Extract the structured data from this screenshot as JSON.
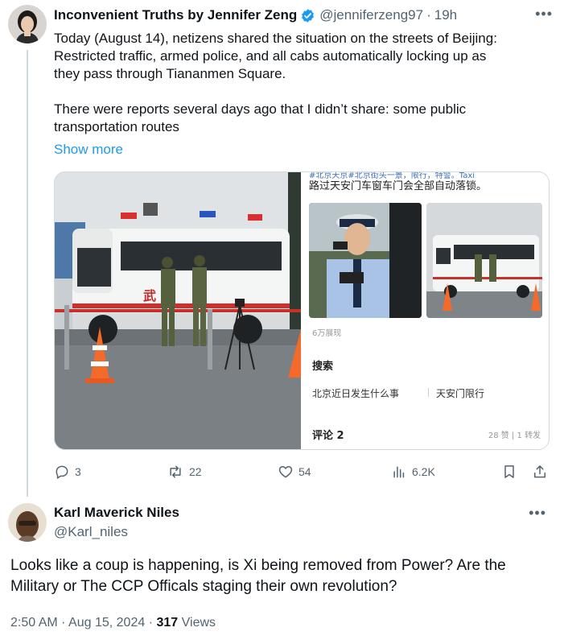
{
  "tweet": {
    "author_name": "Inconvenient Truths by Jennifer Zeng",
    "handle": "@jenniferzeng97",
    "separator": "·",
    "time": "19h",
    "more_icon": "ellipsis-icon",
    "text_lines": [
      "Today (August 14), netizens shared the situation on the streets of Beijing:",
      "Restricted traffic, armed police, and all cabs automatically locking up as",
      "they pass through Tiananmen Square.",
      "There were reports several days ago that I didn’t share: some public",
      "transportation routes"
    ],
    "show_more": "Show more",
    "media": {
      "truck_char": "武",
      "weibo": {
        "top_cut": "#北京天京#北京街头一景，限行，特警。Taxi",
        "top_line": "路过天安门车窗车门会全部自动落锁。",
        "views": "6万展现",
        "search_label": "搜索",
        "search_items": [
          "北京近日发生什么事",
          "天安门限行"
        ],
        "comments": "评论 2",
        "likes": "28 赞 | 1 转发"
      }
    },
    "actions": {
      "replies": "3",
      "retweets": "22",
      "likes": "54",
      "views": "6.2K"
    }
  },
  "reply": {
    "author_name": "Karl Maverick Niles",
    "handle": "@Karl_niles",
    "more_icon": "ellipsis-icon",
    "text": "Looks like a coup is happening, is Xi being removed from Power? Are the Military or The CCP Officals staging their own revolution?",
    "time": "2:50 AM",
    "separator": "·",
    "date": "Aug 15, 2024",
    "view_count": "317",
    "views_label": "Views"
  },
  "colors": {
    "link": "#1d9bf0",
    "secondary_text": "#536471",
    "verified": "#1d9bf0"
  }
}
